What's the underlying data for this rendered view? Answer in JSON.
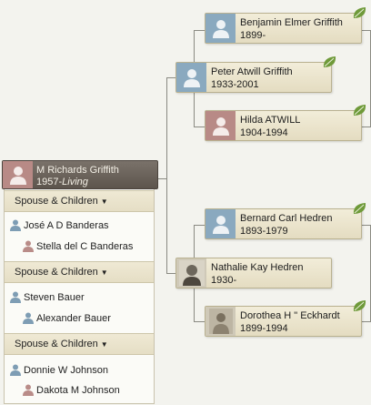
{
  "focus": {
    "name": "M Richards Griffith",
    "birth": "1957-",
    "status": "Living"
  },
  "father": {
    "name": "Peter Atwill Griffith",
    "dates": "1933-2001"
  },
  "mother": {
    "name": "Nathalie Kay Hedren",
    "dates": "1930-"
  },
  "paternal_grandfather": {
    "name": "Benjamin Elmer Griffith",
    "dates": "1899-"
  },
  "paternal_grandmother": {
    "name": "Hilda ATWILL",
    "dates": "1904-1994"
  },
  "maternal_grandfather": {
    "name": "Bernard Carl Hedren",
    "dates": "1893-1979"
  },
  "maternal_grandmother": {
    "name": "Dorothea H \" Eckhardt",
    "dates": "1899-1994"
  },
  "families": [
    {
      "header": "Spouse & Children",
      "spouse": "José A D Banderas",
      "child": "Stella del C Banderas"
    },
    {
      "header": "Spouse & Children",
      "spouse": "Steven Bauer",
      "child": "Alexander Bauer"
    },
    {
      "header": "Spouse & Children",
      "spouse": "Donnie W Johnson",
      "child": "Dakota M Johnson"
    }
  ],
  "colors": {
    "male": "#8aa9bf",
    "female": "#b88a86",
    "hint_leaf": "#6f9a3a",
    "focus_bg": "#6b635b"
  },
  "icons": {
    "hint": "leaf-icon",
    "male": "male-silhouette-icon",
    "female": "female-silhouette-icon",
    "dropdown": "dropdown-arrow-icon"
  }
}
